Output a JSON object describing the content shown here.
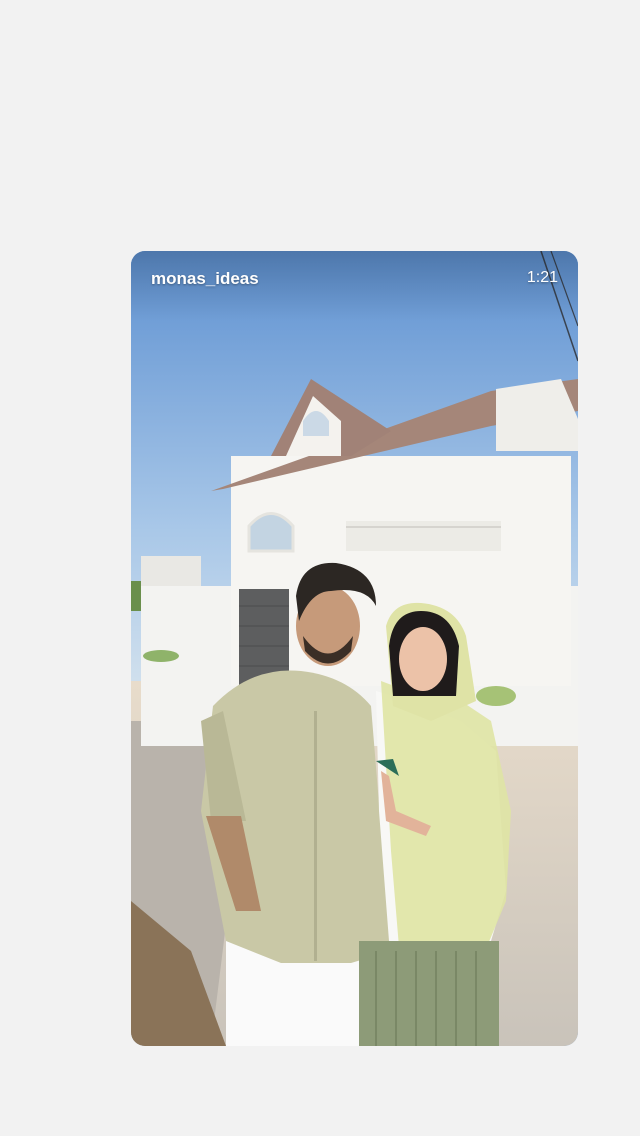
{
  "video": {
    "username": "monas_ideas",
    "duration": "1:21",
    "thumbnail_icon": "video-thumbnail"
  }
}
